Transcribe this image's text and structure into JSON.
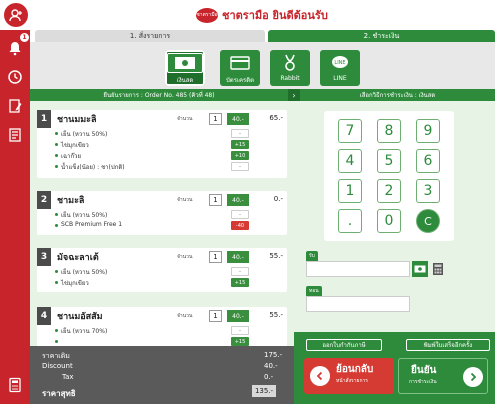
{
  "header": {
    "brand_logo_text": "ชาตรามือ",
    "brand_title": "ชาตรามือ ยินดีต้อนรับ",
    "notification_count": "1"
  },
  "steps": {
    "step1": "1. สั่งรายการ",
    "step2": "2. ชำระเงิน"
  },
  "payment_methods": [
    {
      "label": "เงินสด",
      "icon": "cash-icon",
      "active": true
    },
    {
      "label": "บัตรเครดิต",
      "icon": "credit-card-icon",
      "active": false
    },
    {
      "label": "Rabbit",
      "icon": "rabbit-icon",
      "active": false
    },
    {
      "label": "LINE",
      "icon": "line-icon",
      "active": false
    }
  ],
  "order": {
    "header": "ยืนยันรายการ : Order No. 485 (คิวที่ 48)",
    "qty_label": "จำนวน",
    "items": [
      {
        "no": "1",
        "name": "ชานมมะลิ",
        "qty": "1",
        "unit_price": "40.-",
        "total": "65.-",
        "options": [
          {
            "text": "เย็น (หวาน 50%)",
            "tag": "-",
            "tag_style": "plain"
          },
          {
            "text": "ไข่มุกเขียว",
            "tag": "+15",
            "tag_style": "green"
          },
          {
            "text": "เฉาก๊วย",
            "tag": "+10",
            "tag_style": "green"
          },
          {
            "text": "น้ำแข็ง(น้อย) : ชา(ปกติ)",
            "tag": "-",
            "tag_style": "plain"
          }
        ]
      },
      {
        "no": "2",
        "name": "ชามะลิ",
        "qty": "1",
        "unit_price": "40.-",
        "total": "0.-",
        "options": [
          {
            "text": "เย็น (หวาน 50%)",
            "tag": "-",
            "tag_style": "plain"
          },
          {
            "text": "SCB Premium Free 1",
            "tag": "-40",
            "tag_style": "red"
          }
        ]
      },
      {
        "no": "3",
        "name": "มัจฉะลาเต้",
        "qty": "1",
        "unit_price": "40.-",
        "total": "55.-",
        "options": [
          {
            "text": "เย็น (หวาน 50%)",
            "tag": "-",
            "tag_style": "plain"
          },
          {
            "text": "ไข่มุกเขียว",
            "tag": "+15",
            "tag_style": "green"
          }
        ]
      },
      {
        "no": "4",
        "name": "ชานมอัสสัม",
        "qty": "1",
        "unit_price": "40.-",
        "total": "55.-",
        "options": [
          {
            "text": "เย็น (หวาน 70%)",
            "tag": "-",
            "tag_style": "plain"
          },
          {
            "text": "",
            "tag": "+15",
            "tag_style": "green"
          }
        ]
      }
    ]
  },
  "totals": {
    "subtotal_label": "ราคาเดิม",
    "subtotal": "175.-",
    "discount_label": "Discount",
    "discount": "40.-",
    "tax_label": "Tax",
    "tax": "0.-",
    "grand_label": "ราคาสุทธิ",
    "grand": "135.-"
  },
  "payment": {
    "header": "เลือกวิธีการชำระเงิน : เงินสด",
    "keys": [
      "7",
      "8",
      "9",
      "4",
      "5",
      "6",
      "1",
      "2",
      "3",
      ".",
      "0",
      "C"
    ],
    "received_label": "รับ",
    "received_value": "",
    "change_label": "ทอน",
    "change_value": ""
  },
  "actions": {
    "tax_invoice": "ออกใบกำกับภาษี",
    "reprint": "พิมพ์ใบเสร็จอีกครั้ง",
    "back_title": "ย้อนกลับ",
    "back_sub": "หน้าสั่งรายการ",
    "confirm_title": "ยืนยัน",
    "confirm_sub": "การชำระเงิน"
  },
  "colors": {
    "brand_red": "#c8242c",
    "primary_green": "#2e8b3c",
    "light_green_bg": "#e7f3e4",
    "totals_gray": "#5a5a5a"
  }
}
